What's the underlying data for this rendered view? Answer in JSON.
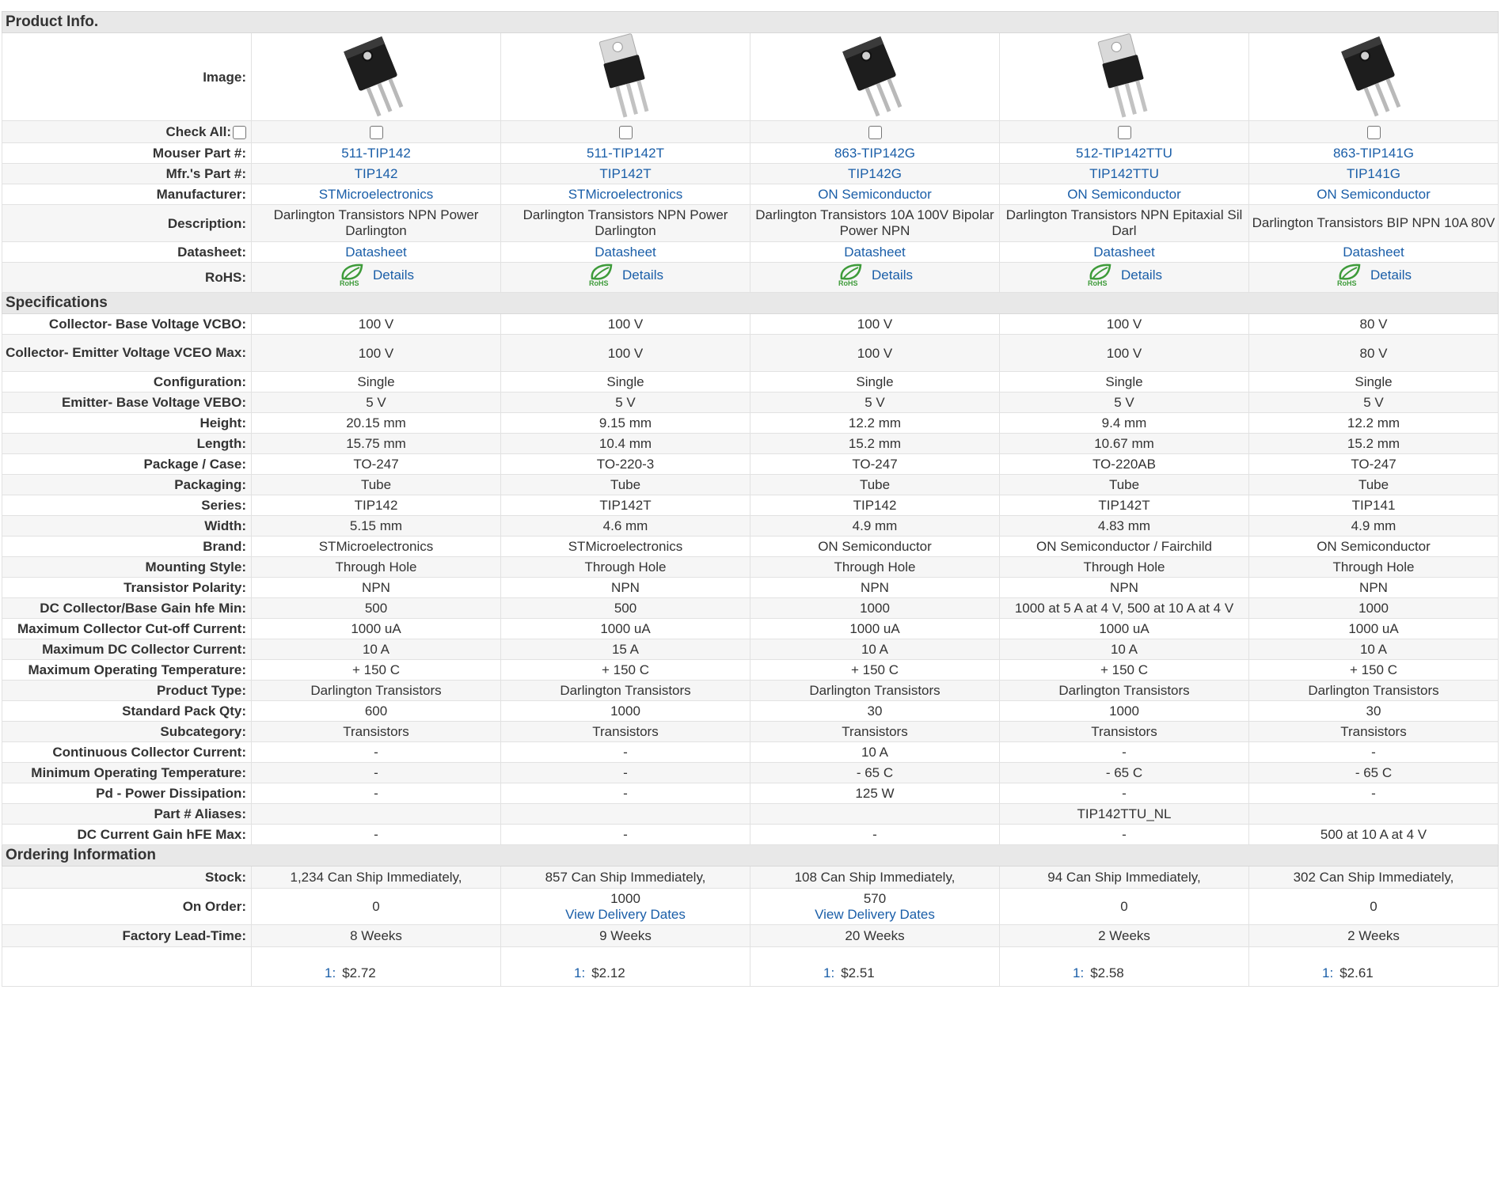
{
  "sections": {
    "product_info": "Product Info.",
    "specifications": "Specifications",
    "ordering": "Ordering Information"
  },
  "labels": {
    "image": "Image:",
    "check_all": "Check All:",
    "mouser_part": "Mouser Part #:",
    "mfr_part": "Mfr.'s Part #:",
    "manufacturer": "Manufacturer:",
    "description": "Description:",
    "datasheet": "Datasheet:",
    "rohs": "RoHS:"
  },
  "products": [
    {
      "mouser": "511-TIP142",
      "mfr": "TIP142",
      "manufacturer": "STMicroelectronics",
      "description": "Darlington Transistors NPN Power Darlington",
      "datasheet": "Datasheet",
      "rohs": "Details",
      "rohs_logo": "RoHS",
      "image_icon": "to247-transistor-icon"
    },
    {
      "mouser": "511-TIP142T",
      "mfr": "TIP142T",
      "manufacturer": "STMicroelectronics",
      "description": "Darlington Transistors NPN Power Darlington",
      "datasheet": "Datasheet",
      "rohs": "Details",
      "rohs_logo": "RoHS",
      "image_icon": "to220-transistor-icon"
    },
    {
      "mouser": "863-TIP142G",
      "mfr": "TIP142G",
      "manufacturer": "ON Semiconductor",
      "description": "Darlington Transistors 10A 100V Bipolar Power NPN",
      "datasheet": "Datasheet",
      "rohs": "Details",
      "rohs_logo": "RoHS",
      "image_icon": "to247-transistor-icon"
    },
    {
      "mouser": "512-TIP142TTU",
      "mfr": "TIP142TTU",
      "manufacturer": "ON Semiconductor",
      "description": "Darlington Transistors NPN Epitaxial Sil Darl",
      "datasheet": "Datasheet",
      "rohs": "Details",
      "rohs_logo": "RoHS",
      "image_icon": "to220-transistor-icon"
    },
    {
      "mouser": "863-TIP141G",
      "mfr": "TIP141G",
      "manufacturer": "ON Semiconductor",
      "description": "Darlington Transistors BIP NPN 10A 80V",
      "datasheet": "Datasheet",
      "rohs": "Details",
      "rohs_logo": "RoHS",
      "image_icon": "to247-transistor-icon"
    }
  ],
  "specs": [
    {
      "label": "Collector- Base Voltage VCBO:",
      "values": [
        "100 V",
        "100 V",
        "100 V",
        "100 V",
        "80 V"
      ]
    },
    {
      "label": "Collector- Emitter Voltage VCEO Max:",
      "values": [
        "100 V",
        "100 V",
        "100 V",
        "100 V",
        "80 V"
      ]
    },
    {
      "label": "Configuration:",
      "values": [
        "Single",
        "Single",
        "Single",
        "Single",
        "Single"
      ]
    },
    {
      "label": "Emitter- Base Voltage VEBO:",
      "values": [
        "5 V",
        "5 V",
        "5 V",
        "5 V",
        "5 V"
      ]
    },
    {
      "label": "Height:",
      "values": [
        "20.15 mm",
        "9.15 mm",
        "12.2 mm",
        "9.4 mm",
        "12.2 mm"
      ]
    },
    {
      "label": "Length:",
      "values": [
        "15.75 mm",
        "10.4 mm",
        "15.2 mm",
        "10.67 mm",
        "15.2 mm"
      ]
    },
    {
      "label": "Package / Case:",
      "values": [
        "TO-247",
        "TO-220-3",
        "TO-247",
        "TO-220AB",
        "TO-247"
      ]
    },
    {
      "label": "Packaging:",
      "values": [
        "Tube",
        "Tube",
        "Tube",
        "Tube",
        "Tube"
      ]
    },
    {
      "label": "Series:",
      "values": [
        "TIP142",
        "TIP142T",
        "TIP142",
        "TIP142T",
        "TIP141"
      ]
    },
    {
      "label": "Width:",
      "values": [
        "5.15 mm",
        "4.6 mm",
        "4.9 mm",
        "4.83 mm",
        "4.9 mm"
      ]
    },
    {
      "label": "Brand:",
      "values": [
        "STMicroelectronics",
        "STMicroelectronics",
        "ON Semiconductor",
        "ON Semiconductor / Fairchild",
        "ON Semiconductor"
      ]
    },
    {
      "label": "Mounting Style:",
      "values": [
        "Through Hole",
        "Through Hole",
        "Through Hole",
        "Through Hole",
        "Through Hole"
      ]
    },
    {
      "label": "Transistor Polarity:",
      "values": [
        "NPN",
        "NPN",
        "NPN",
        "NPN",
        "NPN"
      ]
    },
    {
      "label": "DC Collector/Base Gain hfe Min:",
      "values": [
        "500",
        "500",
        "1000",
        "1000 at 5 A at 4 V, 500 at 10 A at 4 V",
        "1000"
      ]
    },
    {
      "label": "Maximum Collector Cut-off Current:",
      "values": [
        "1000 uA",
        "1000 uA",
        "1000 uA",
        "1000 uA",
        "1000 uA"
      ]
    },
    {
      "label": "Maximum DC Collector Current:",
      "values": [
        "10 A",
        "15 A",
        "10 A",
        "10 A",
        "10 A"
      ]
    },
    {
      "label": "Maximum Operating Temperature:",
      "values": [
        "+ 150 C",
        "+ 150 C",
        "+ 150 C",
        "+ 150 C",
        "+ 150 C"
      ]
    },
    {
      "label": "Product Type:",
      "values": [
        "Darlington Transistors",
        "Darlington Transistors",
        "Darlington Transistors",
        "Darlington Transistors",
        "Darlington Transistors"
      ]
    },
    {
      "label": "Standard Pack Qty:",
      "values": [
        "600",
        "1000",
        "30",
        "1000",
        "30"
      ]
    },
    {
      "label": "Subcategory:",
      "values": [
        "Transistors",
        "Transistors",
        "Transistors",
        "Transistors",
        "Transistors"
      ]
    },
    {
      "label": "Continuous Collector Current:",
      "values": [
        "-",
        "-",
        "10 A",
        "-",
        "-"
      ]
    },
    {
      "label": "Minimum Operating Temperature:",
      "values": [
        "-",
        "-",
        "- 65 C",
        "- 65 C",
        "- 65 C"
      ]
    },
    {
      "label": "Pd - Power Dissipation:",
      "values": [
        "-",
        "-",
        "125 W",
        "-",
        "-"
      ]
    },
    {
      "label": "Part # Aliases:",
      "values": [
        "",
        "",
        "",
        "TIP142TTU_NL",
        ""
      ]
    },
    {
      "label": "DC Current Gain hFE Max:",
      "values": [
        "-",
        "-",
        "-",
        "-",
        "500 at 10 A at 4 V"
      ]
    }
  ],
  "ordering": {
    "stock_label": "Stock:",
    "on_order_label": "On Order:",
    "lead_label": "Factory Lead-Time:",
    "delivery_link": "View Delivery Dates",
    "stock": [
      "1,234 Can Ship Immediately,",
      "857 Can Ship Immediately,",
      "108 Can Ship Immediately,",
      "94 Can Ship Immediately,",
      "302 Can Ship Immediately,"
    ],
    "on_order": [
      "0",
      "1000",
      "570",
      "0",
      "0"
    ],
    "show_delivery": [
      false,
      true,
      true,
      false,
      false
    ],
    "lead_time": [
      "8 Weeks",
      "9 Weeks",
      "20 Weeks",
      "2 Weeks",
      "2 Weeks"
    ],
    "price_qty": [
      "1:",
      "1:",
      "1:",
      "1:",
      "1:"
    ],
    "price": [
      "$2.72",
      "$2.12",
      "$2.51",
      "$2.58",
      "$2.61"
    ]
  },
  "colors": {
    "link": "#1a5ea8",
    "section_bg": "#e8e8e8",
    "alt_row_bg": "#f6f6f6",
    "rohs_green": "#3e9b3a"
  }
}
